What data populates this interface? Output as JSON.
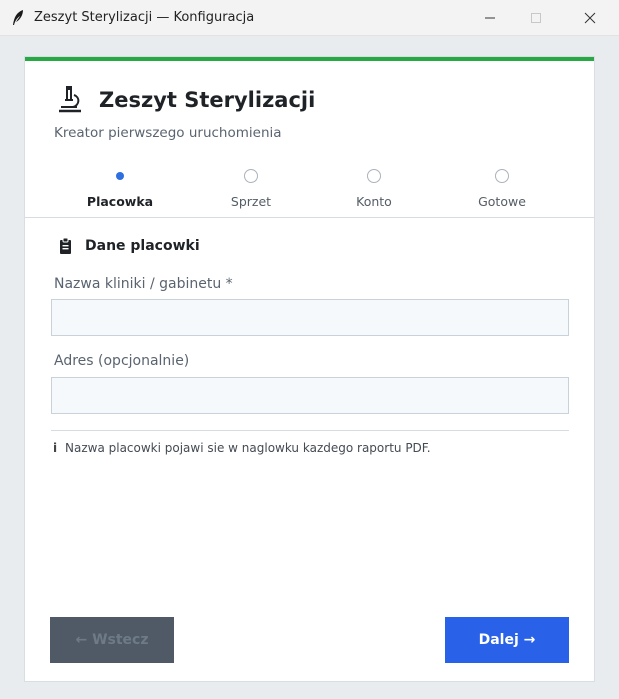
{
  "window": {
    "title": "Zeszyt Sterylizacji — Konfiguracja"
  },
  "header": {
    "app_title": "Zeszyt Sterylizacji",
    "subtitle": "Kreator pierwszego uruchomienia",
    "accent_color": "#28a745"
  },
  "steps": [
    {
      "label": "Placowka",
      "active": true
    },
    {
      "label": "Sprzet",
      "active": false
    },
    {
      "label": "Konto",
      "active": false
    },
    {
      "label": "Gotowe",
      "active": false
    }
  ],
  "section": {
    "title": "Dane placowki",
    "fields": [
      {
        "label": "Nazwa kliniki / gabinetu *",
        "value": "",
        "placeholder": ""
      },
      {
        "label": "Adres (opcjonalnie)",
        "value": "",
        "placeholder": ""
      }
    ],
    "info": "Nazwa placowki pojawi sie w naglowku kazdego raportu PDF."
  },
  "buttons": {
    "back": "← Wstecz",
    "next": "Dalej →"
  },
  "icons": {
    "app": "feather-icon",
    "logo": "microscope-icon",
    "section": "clipboard-icon",
    "info": "info-icon"
  },
  "colors": {
    "primary": "#2962e8",
    "step_active": "#2f6fe0",
    "back_disabled": "#4f5a66"
  }
}
